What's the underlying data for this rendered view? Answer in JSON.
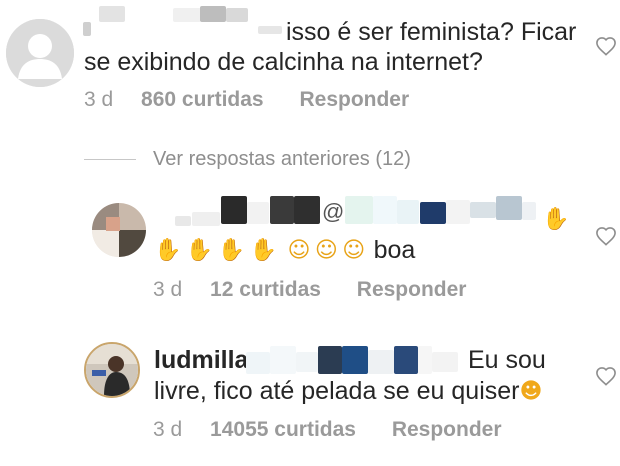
{
  "comments": [
    {
      "line1": "isso é ser feminista? Ficar",
      "line2": "se exibindo de calcinha na internet?",
      "ago": "3 d",
      "likes": "860 curtidas",
      "reply": "Responder"
    }
  ],
  "view_replies": "Ver respostas anteriores (12)",
  "replies": [
    {
      "username_fragment": "@",
      "emoji_line_text": "boa",
      "ago": "3 d",
      "likes": "12 curtidas",
      "reply": "Responder"
    },
    {
      "username": "ludmilla",
      "text1": "Eu sou",
      "text2": "livre, fico até pelada se eu quiser",
      "ago": "3 d",
      "likes": "14055 curtidas",
      "reply": "Responder"
    }
  ],
  "icons": {
    "wave": "waving-hand-icon",
    "grin": "grinning-face-icon",
    "kiss": "face-blowing-kiss-icon",
    "heart": "heart-outline-icon"
  },
  "colors": {
    "text": "#262626",
    "meta": "#8e8e8e",
    "divider": "#c7c7c7"
  }
}
